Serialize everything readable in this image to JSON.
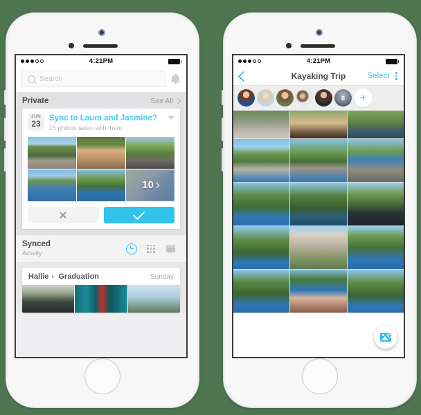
{
  "background_color": "#4e7450",
  "accent_color": "#33c3ef",
  "phone_left": {
    "status_bar": {
      "signal_filled": 3,
      "signal_empty": 2,
      "time": "4:21PM",
      "battery": "full"
    },
    "search": {
      "placeholder": "Search",
      "icon": "search-icon",
      "bell_icon": "bell-icon"
    },
    "section": {
      "title": "Private",
      "see_all": "See All",
      "chevron": "chevron-right-icon"
    },
    "card": {
      "date_month": "JUN",
      "date_day": "23",
      "title": "Sync to Laura and Jasmine?",
      "subtitle": "15 photos taken with them",
      "caret_icon": "caret-down-icon",
      "thumbnails": [
        {
          "name": "thumb-1",
          "overlay": null
        },
        {
          "name": "thumb-2",
          "overlay": null
        },
        {
          "name": "thumb-3",
          "overlay": null
        },
        {
          "name": "thumb-4",
          "overlay": null
        },
        {
          "name": "thumb-5",
          "overlay": null
        },
        {
          "name": "thumb-6",
          "overlay": "10"
        }
      ],
      "decline_icon": "close-icon",
      "accept_icon": "check-icon"
    },
    "synced": {
      "title": "Synced",
      "subtitle": "Activity",
      "icons": [
        "clock-icon",
        "grid-icon",
        "box-icon"
      ],
      "active_icon": "clock-icon"
    },
    "activity": {
      "user": "Hallie",
      "separator_icon": "caret-right-icon",
      "event": "Graduation",
      "day": "Sunday"
    }
  },
  "phone_right": {
    "status_bar": {
      "signal_filled": 3,
      "signal_empty": 2,
      "time": "4:21PM",
      "battery": "full"
    },
    "nav": {
      "back_icon": "chevron-left-icon",
      "title": "Kayaking Trip",
      "select_label": "Select",
      "overflow_icon": "kebab-menu-icon"
    },
    "avatars": [
      {
        "name": "avatar-1"
      },
      {
        "name": "avatar-2"
      },
      {
        "name": "avatar-3"
      },
      {
        "name": "avatar-4"
      },
      {
        "name": "avatar-5"
      },
      {
        "name": "avatar-count",
        "count": "8"
      }
    ],
    "add_member_label": "+",
    "photo_count_rows": 5,
    "photo_columns": 3,
    "fab": {
      "icon": "add-photo-icon",
      "plus": "+"
    }
  }
}
